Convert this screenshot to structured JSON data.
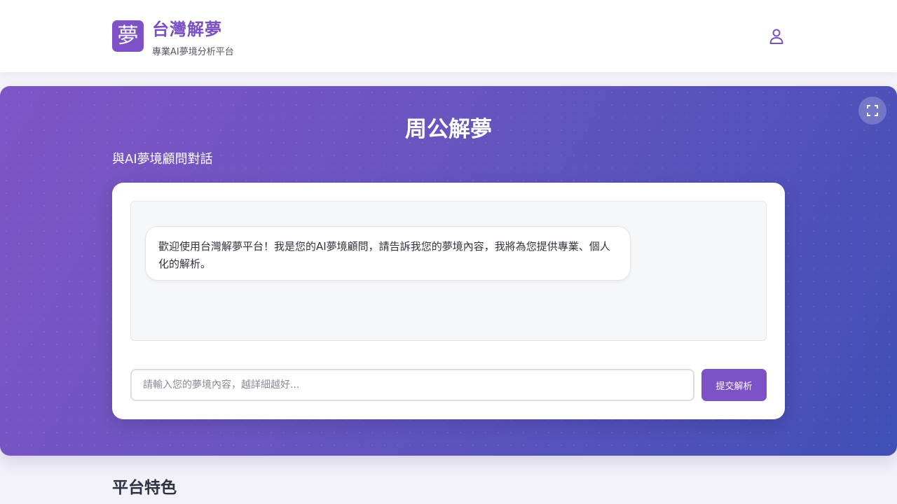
{
  "header": {
    "logo_char": "夢",
    "title": "台灣解夢",
    "subtitle": "專業AI夢境分析平台",
    "user_icon": "user-icon"
  },
  "hero": {
    "title": "周公解夢",
    "subtitle": "與AI夢境顧問對話",
    "fullscreen_icon": "fullscreen-icon"
  },
  "chat": {
    "messages": [
      {
        "role": "assistant",
        "text": "歡迎使用台灣解夢平台！我是您的AI夢境顧問，請告訴我您的夢境內容，我將為您提供專業、個人化的解析。"
      }
    ],
    "input": {
      "value": "",
      "placeholder": "請輸入您的夢境內容，越詳細越好..."
    },
    "submit_label": "提交解析"
  },
  "features": {
    "title": "平台特色"
  },
  "colors": {
    "accent": "#7e52c6",
    "hero_gradient_start": "#7f55c4",
    "hero_gradient_end": "#3f50b5"
  }
}
